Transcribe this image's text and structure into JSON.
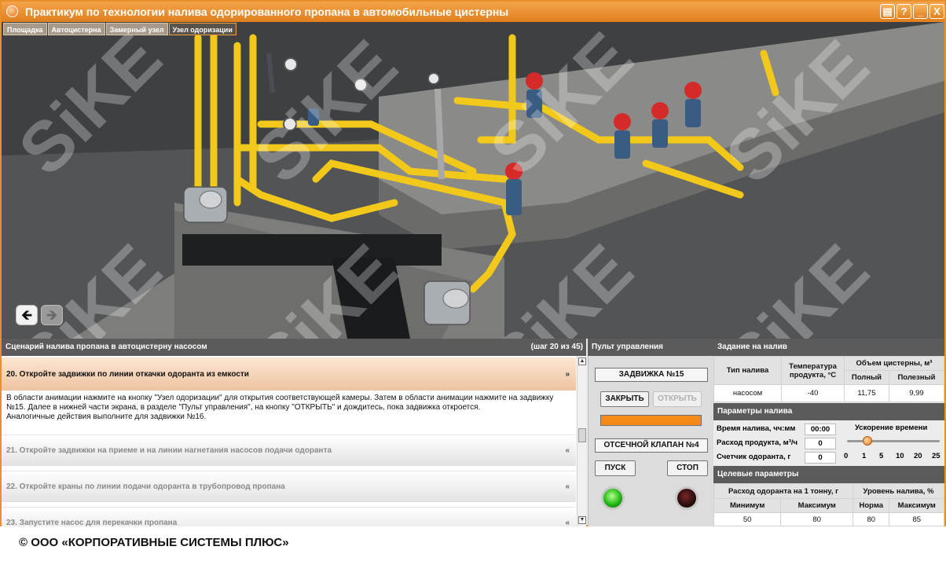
{
  "window": {
    "title": "Практикум по технологии налива одорированного пропана в автомобильные цистерны",
    "buttons": [
      "▤",
      "?",
      "_",
      "X"
    ]
  },
  "tabs": [
    {
      "label": "Площадка",
      "active": false
    },
    {
      "label": "Автоцистерна",
      "active": false
    },
    {
      "label": "Замерный узел",
      "active": false
    },
    {
      "label": "Узел одоризации",
      "active": true
    }
  ],
  "viewport": {
    "watermark": "SiKE",
    "nav_back": "🡸",
    "nav_forward": "🡺"
  },
  "scenario": {
    "title": "Сценарий налива пропана в автоцистерну насосом",
    "step_counter": "(шаг 20 из 45)",
    "current_step": {
      "title": "20. Откройте задвижки по линии откачки одоранта из емкости",
      "description": "В области анимации нажмите на кнопку \"Узел одоризации\" для открытия соответствующей камеры. Затем в области анимации нажмите на задвижку №15. Далее в нижней части экрана, в разделе \"Пульт управления\", на кнопку \"ОТКРЫТЬ\" и дождитесь, пока задвижка откроется.",
      "description2": "Аналогичные действия выполните для задвижки №16."
    },
    "next_steps": [
      "21. Откройте задвижки на приеме и на линии нагнетания насосов подачи одоранта",
      "22. Откройте краны по линии подачи одоранта в трубопровод пропана",
      "23. Запустите насос для перекачки пропана"
    ],
    "chevron_open": "»",
    "chevron_closed": "«"
  },
  "control_panel": {
    "title": "Пульт управления",
    "valve_label": "ЗАДВИЖКА №15",
    "close_label": "ЗАКРЫТЬ",
    "open_label": "ОТКРЫТЬ",
    "cutoff_label": "ОТСЕЧНОЙ КЛАПАН №4",
    "start_label": "ПУСК",
    "stop_label": "СТОП",
    "progress_color": "#f58a18"
  },
  "task": {
    "title": "Задание на налив",
    "col_type": "Тип налива",
    "col_temp": "Температура продукта, °С",
    "col_volume": "Объем цистерны, м³",
    "col_full": "Полный",
    "col_useful": "Полезный",
    "row": {
      "type": "насосом",
      "temp": "-40",
      "full": "11,75",
      "useful": "9,99"
    }
  },
  "params": {
    "title": "Параметры налива",
    "time_label": "Время налива, чч:мм",
    "time_value": "00:00",
    "flow_label": "Расход продукта, м³/ч",
    "flow_value": "0",
    "counter_label": "Счетчик одоранта, г",
    "counter_value": "0",
    "speed_title": "Ускорение времени",
    "speed_ticks": [
      "0",
      "1",
      "5",
      "10",
      "20",
      "25"
    ],
    "speed_value": "1"
  },
  "targets": {
    "title": "Целевые параметры",
    "col_odorant": "Расход одоранта на 1 тонну, г",
    "col_level": "Уровень налива, %",
    "min_label": "Минимум",
    "max_label": "Максимум",
    "norm_label": "Норма",
    "max2_label": "Максимум",
    "row": {
      "min": "50",
      "max": "80",
      "norm": "80",
      "max2": "85"
    }
  },
  "footer": "© ООО «КОРПОРАТИВНЫЕ СИСТЕМЫ ПЛЮС»",
  "colors": {
    "accent": "#e8902a",
    "pipe": "#f2c81a",
    "valve": "#d42a2a"
  }
}
